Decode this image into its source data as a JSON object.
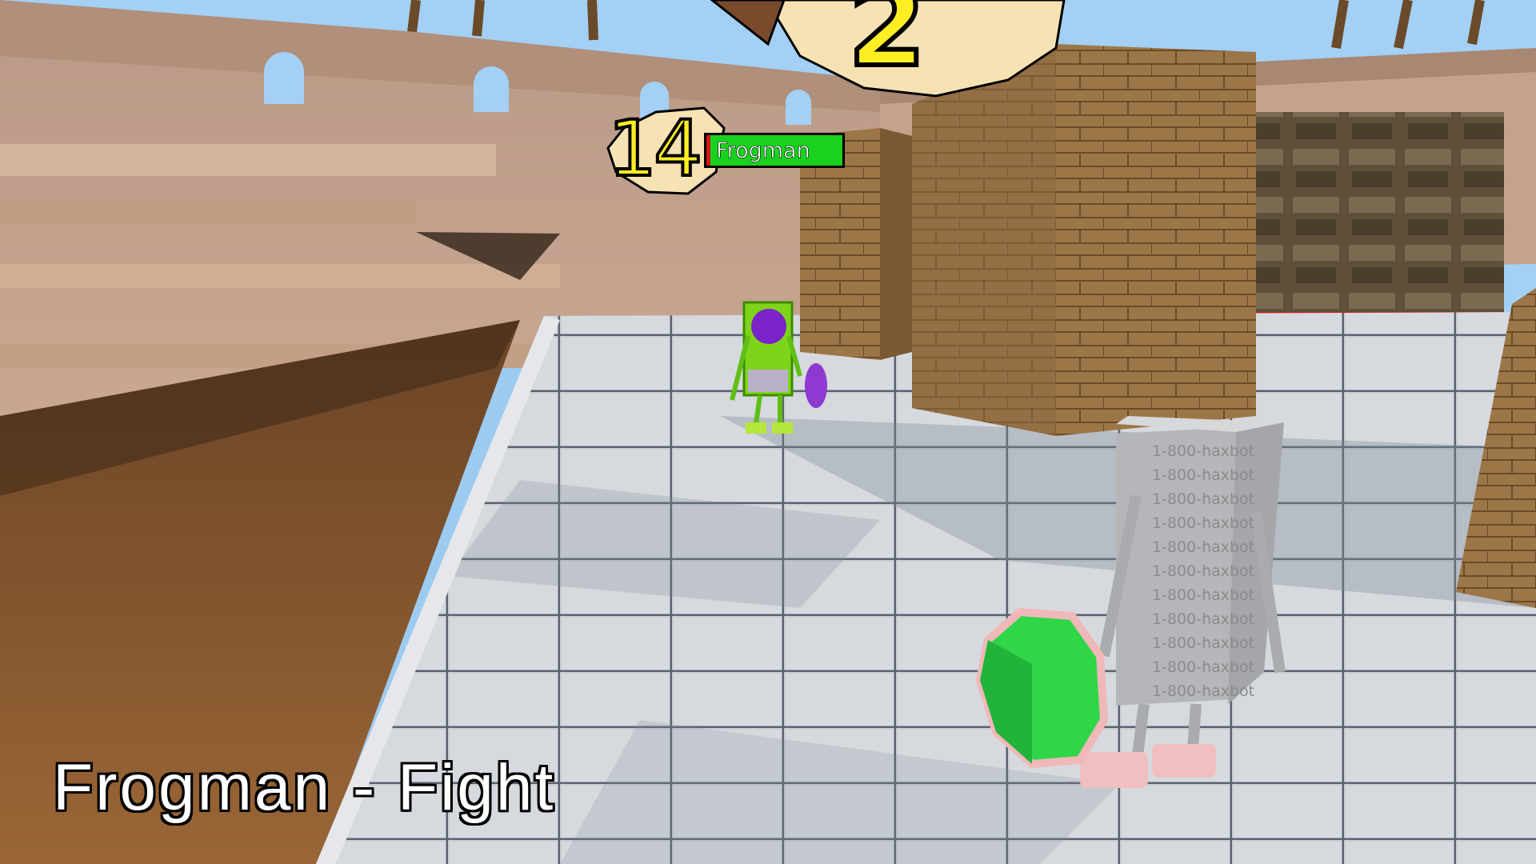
{
  "hud": {
    "round_number": "2",
    "enemy": {
      "level": "14",
      "name": "Frogman",
      "health_fraction": 0.97
    },
    "status_caption": "Frogman - Fight"
  },
  "player": {
    "body_text": "1-800-haxbot"
  },
  "colors": {
    "sky": "#9ccbf2",
    "arena_wall": "#c9a58f",
    "sand": "#8a5a30",
    "floor_tile": "#c7ccd0",
    "crate": "#9a7446",
    "health_green": "#18d21e",
    "health_red": "#d01515",
    "frogman_green": "#7ed41a",
    "frogman_purple": "#7b22c8",
    "shield_green": "#2fd648"
  },
  "icons": {
    "level_badge": "parchment-blob-icon",
    "round_badge": "parchment-blob-icon"
  }
}
